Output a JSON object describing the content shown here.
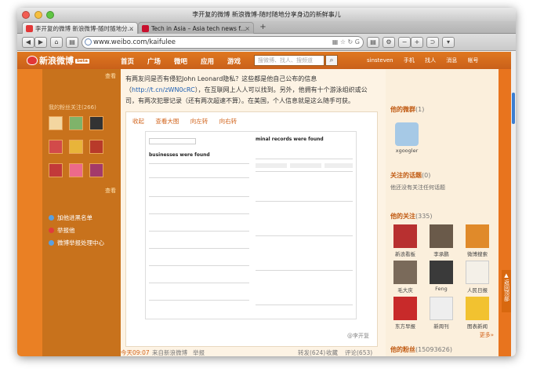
{
  "window": {
    "title": "李开复的微博 新浪微博-随时随地分享身边的新鲜事儿"
  },
  "tabs": [
    {
      "label": "李开复的微博 新浪微博-随时随地分...",
      "active": true
    },
    {
      "label": "Tech in Asia – Asia tech news f...",
      "active": false
    }
  ],
  "toolbar": {
    "url": "www.weibo.com/kaifulee"
  },
  "weibo_nav": {
    "logo": "新浪微博",
    "beta": "beta",
    "items": [
      "首页",
      "广场",
      "微吧",
      "应用",
      "游戏"
    ],
    "search_placeholder": "搜微博、找人、搜频道",
    "right_items": [
      "sinsteven",
      "手机",
      "找人",
      "消息",
      "帐号"
    ]
  },
  "left_col": {
    "more1": "查看",
    "hd": "我的粉丝关注(266)",
    "more2": "查看",
    "icon_labels": [
      "",
      "",
      "",
      "",
      ""
    ],
    "links": [
      "加他进黑名单",
      "举报他",
      "微博举报处理中心"
    ]
  },
  "post": {
    "text_before": "有两友问是否有侵犯John Leonard隐私？这些都是他自己公布的信息（",
    "link": "http://t.cn/zWN0cRC",
    "text_after": "），在互联网上人人可以找到。另外，他拥有十个游泳组织或公司，有两次犯罪记录（还有两次超速不算）。在美国，个人信息就是这么随手可获。",
    "actions": [
      "收起",
      "查看大图",
      "向左转",
      "向右转"
    ],
    "doc": {
      "left_title": "businesses were found",
      "right_title": "minal records were found"
    },
    "watermark": "@李开复",
    "meta_left": "今天09:07",
    "meta_source": "来自新浪微博",
    "meta_report": "举报",
    "meta_right": [
      "转发(624)",
      "收藏",
      "评论(653)"
    ]
  },
  "right_col": {
    "tags_title": "他的微群",
    "tags_count": "(1)",
    "group_name": "xgoogler",
    "topics_title": "关注的话题",
    "topics_count": "(0)",
    "topics_empty": "他还没有关注任何话题",
    "follows_title": "他的关注",
    "follows_count": "(335)",
    "follows": [
      "新浪看板",
      "李承鹏",
      "微博搜索",
      "毛大庆",
      "Feng",
      "人民日报",
      "东方早报",
      "新周刊",
      "图表新闻"
    ],
    "more": "更多»",
    "fans_title": "他的粉丝",
    "fans_count": "(15093626)"
  },
  "backtop": "返回顶部",
  "colors": {
    "orange": "#ea8024",
    "dark_orange": "#c8721c",
    "link_blue": "#1d5fb3"
  }
}
